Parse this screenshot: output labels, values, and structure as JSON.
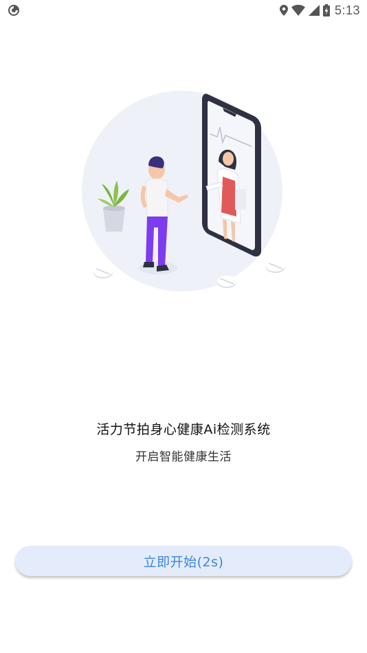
{
  "status_bar": {
    "left_icon": "app-notification-icon",
    "icons": [
      "location-icon",
      "wifi-icon",
      "signal-icon",
      "battery-charging-icon"
    ],
    "time": "5:13",
    "icon_color": "#555555"
  },
  "splash": {
    "illustration": "doctor-consultation-illustration",
    "title": "活力节拍身心健康Ai检测系统",
    "subtitle": "开启智能健康生活"
  },
  "start_button": {
    "label": "立即开始(2s)",
    "text_color": "#3b86e0",
    "background_color": "#e4ecfb"
  }
}
